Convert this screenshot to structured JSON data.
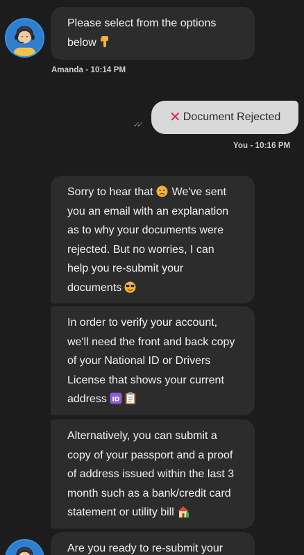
{
  "messages": [
    {
      "sender": "agent",
      "text": "Please select from the options\nbelow",
      "emoji": "pointing-down-emoji",
      "meta": "Amanda - 10:14 PM"
    },
    {
      "sender": "user",
      "text": "Document Rejected",
      "icon": "cross-mark-icon",
      "meta": "You - 10:16 PM"
    },
    {
      "sender": "agent",
      "text": "Sorry to hear that",
      "text_after_emoji": "We've sent\nyou an email with an explanation\nas to why your documents were\nrejected. But no worries, I can\nhelp you re-submit your\ndocuments",
      "emoji": "disappointed-face-emoji",
      "emoji_end": "smiling-face-sunglasses-emoji"
    },
    {
      "sender": "agent",
      "text": "In order to verify your account,\nwe'll need the front and back copy\nof your National ID or Drivers\nLicense that shows your current\naddress",
      "emoji": "id-button-emoji",
      "emoji_2": "clipboard-emoji"
    },
    {
      "sender": "agent",
      "text": "Alternatively, you can submit a\ncopy of your passport and a proof\nof address issued within the last 3\nmonth such as a bank/credit card\nstatement or utility bill",
      "emoji": "house-emoji"
    },
    {
      "sender": "agent",
      "text": "Are you ready to re-submit your"
    }
  ],
  "colors": {
    "background": "#1c1c1c",
    "agent_bubble": "#2c2c2c",
    "user_bubble": "#d9d9d9",
    "avatar_ring": "#3a8fe0",
    "reject_icon": "#e0224b"
  }
}
